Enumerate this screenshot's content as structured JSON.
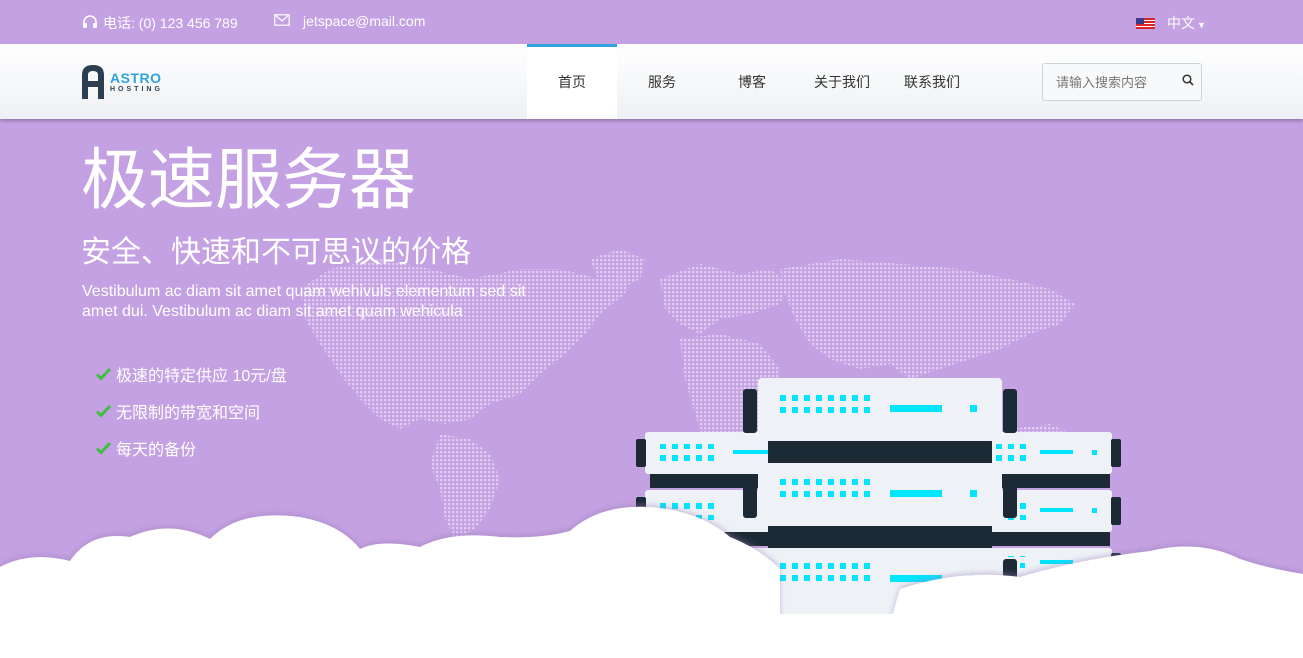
{
  "topbar": {
    "phone": "电话: (0) 123 456 789",
    "email": "jetspace@mail.com",
    "language": "中文",
    "icons": {
      "phone": "headset-icon",
      "email": "envelope-icon",
      "flag": "us-flag-icon",
      "caret": "caret-down-icon"
    }
  },
  "brand": {
    "logo_letter": "A",
    "name_line1": "ASTRO",
    "name_line2": "HOSTING",
    "accent_color": "#2fa3df",
    "dark_color": "#2c3e50"
  },
  "nav": {
    "items": [
      {
        "label": "首页",
        "active": true
      },
      {
        "label": "服务",
        "active": false
      },
      {
        "label": "博客",
        "active": false
      },
      {
        "label": "关于我们",
        "active": false
      },
      {
        "label": "联系我们",
        "active": false
      }
    ]
  },
  "search": {
    "placeholder": "请输入搜索内容",
    "icon": "search-icon"
  },
  "hero": {
    "title": "极速服务器",
    "subtitle": "安全、快速和不可思议的价格",
    "description": "Vestibulum ac diam sit amet quam wehivuls elementum sed sit amet dui. Vestibulum ac diam sit amet quam wehicula",
    "features": [
      "极速的特定供应 10元/盘",
      "无限制的带宽和空间",
      "每天的备份"
    ],
    "background_color": "#c4a1e2",
    "check_color": "#3fbf3f",
    "server_light_color": "#00e5ff"
  }
}
